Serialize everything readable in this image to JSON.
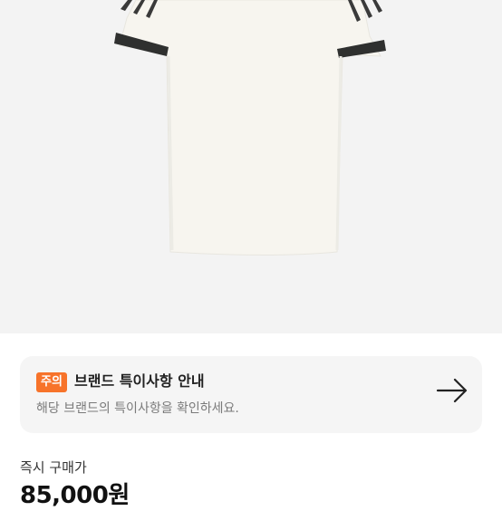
{
  "notice": {
    "badge": "주의",
    "title": "브랜드 특이사항 안내",
    "subtitle": "해당 브랜드의 특이사항을 확인하세요.",
    "arrow_icon": "arrow-right-icon"
  },
  "purchase": {
    "label": "즉시 구매가",
    "price": "85,000원"
  },
  "colors": {
    "badge": "#f7732a",
    "hero_bg": "#f3f3f3",
    "card_bg": "#f5f5f5"
  }
}
